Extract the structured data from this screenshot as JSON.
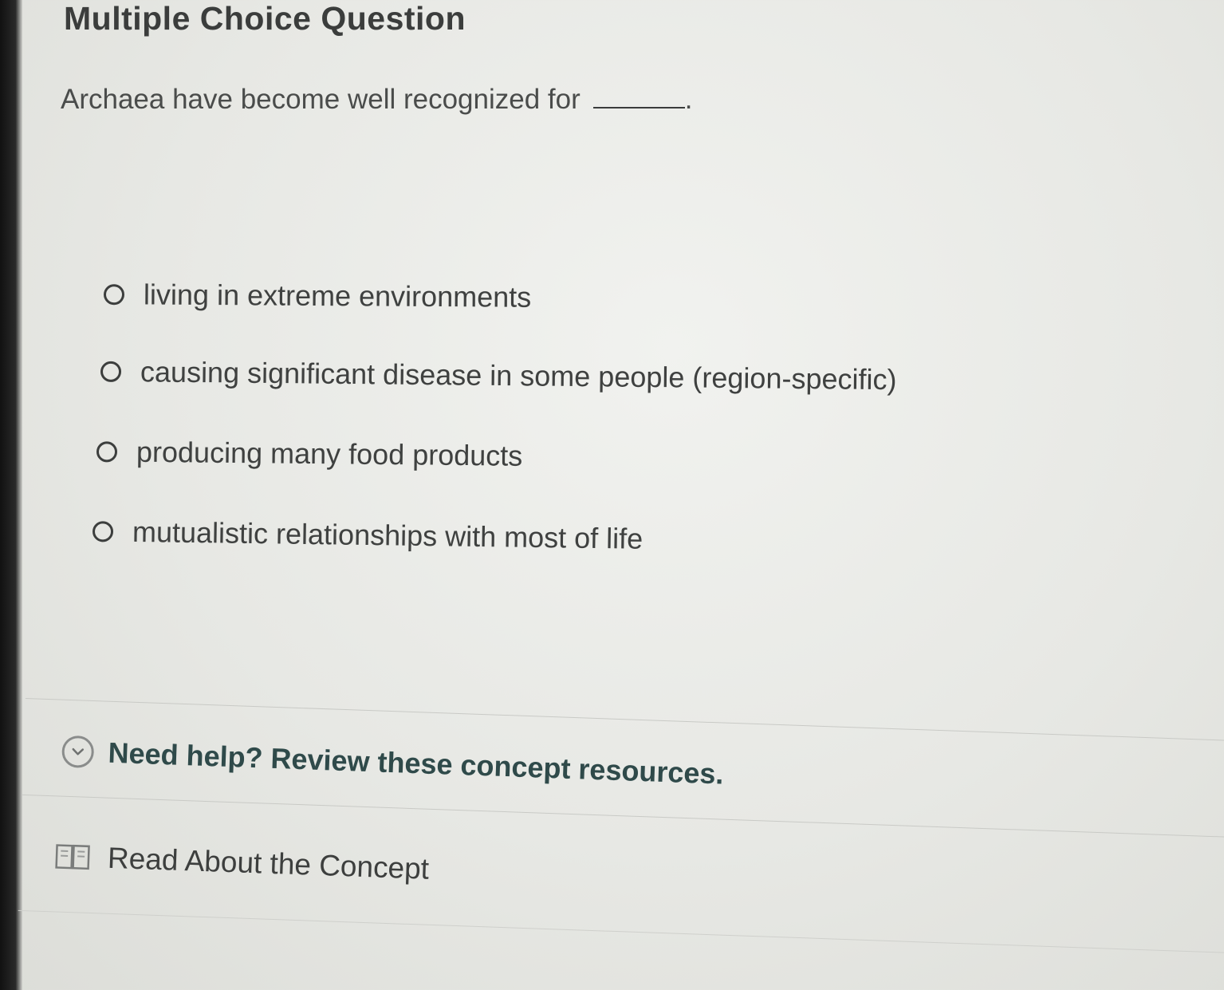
{
  "question": {
    "heading": "Multiple Choice Question",
    "prompt": "Archaea have become well recognized for",
    "prompt_end": "."
  },
  "options": [
    {
      "label": "living in extreme environments",
      "selected": false
    },
    {
      "label": "causing significant disease in some people (region-specific)",
      "selected": false
    },
    {
      "label": "producing many food products",
      "selected": false
    },
    {
      "label": "mutualistic relationships with most of life",
      "selected": false
    }
  ],
  "help": {
    "toggle_label": "Need help? Review these concept resources.",
    "toggle_icon": "chevron-down-icon",
    "resources": [
      {
        "label": "Read About the Concept",
        "icon": "book-icon"
      }
    ]
  },
  "colors": {
    "background": "#e9eae6",
    "text": "#3a3c3b",
    "help_text": "#2f4a4a"
  }
}
